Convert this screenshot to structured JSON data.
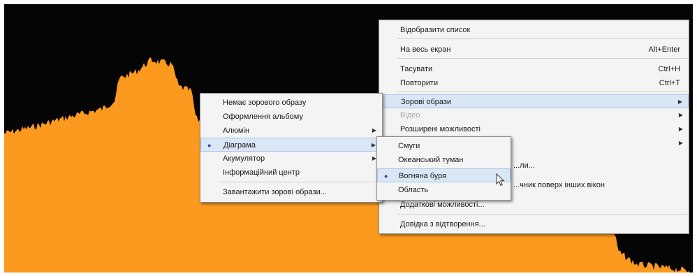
{
  "colors": {
    "visualization": "#fb9a1f",
    "background": "#050505",
    "menu_bg": "#f4f4f4",
    "highlight": "#d9e6f6"
  },
  "main_menu": {
    "items": [
      {
        "label": "Відобразити список"
      },
      {
        "label": "На весь екран",
        "shortcut": "Alt+Enter"
      },
      {
        "label": "Тасувати",
        "shortcut": "Ctrl+H"
      },
      {
        "label": "Повторити",
        "shortcut": "Ctrl+T"
      },
      {
        "label": "Зорові образи",
        "arrow": "▶"
      },
      {
        "label": "Відео",
        "arrow": "▶"
      },
      {
        "label": "Розширені можливості",
        "arrow": "▶"
      },
      {
        "label": "",
        "arrow": "▶"
      },
      {
        "label": "...ли..."
      },
      {
        "label": "...чник поверх інших вікон"
      },
      {
        "label": "Додаткові можливості..."
      },
      {
        "label": "Довідка з відтворення..."
      }
    ]
  },
  "visuals_menu": {
    "items": [
      {
        "label": "Немає зорового образу"
      },
      {
        "label": "Оформлення альбому"
      },
      {
        "label": "Алюмін",
        "arrow": "▶"
      },
      {
        "label": "Діаграма",
        "arrow": "▶",
        "bullet": "●"
      },
      {
        "label": "Акумулятор",
        "arrow": "▶"
      },
      {
        "label": "Інформаційний центр"
      },
      {
        "label": "Завантажити зорові образи..."
      }
    ]
  },
  "chart_submenu": {
    "items": [
      {
        "label": "Смуги"
      },
      {
        "label": "Океанський туман"
      },
      {
        "label": "Вогняна буря",
        "bullet": "●"
      },
      {
        "label": "Область"
      }
    ]
  }
}
